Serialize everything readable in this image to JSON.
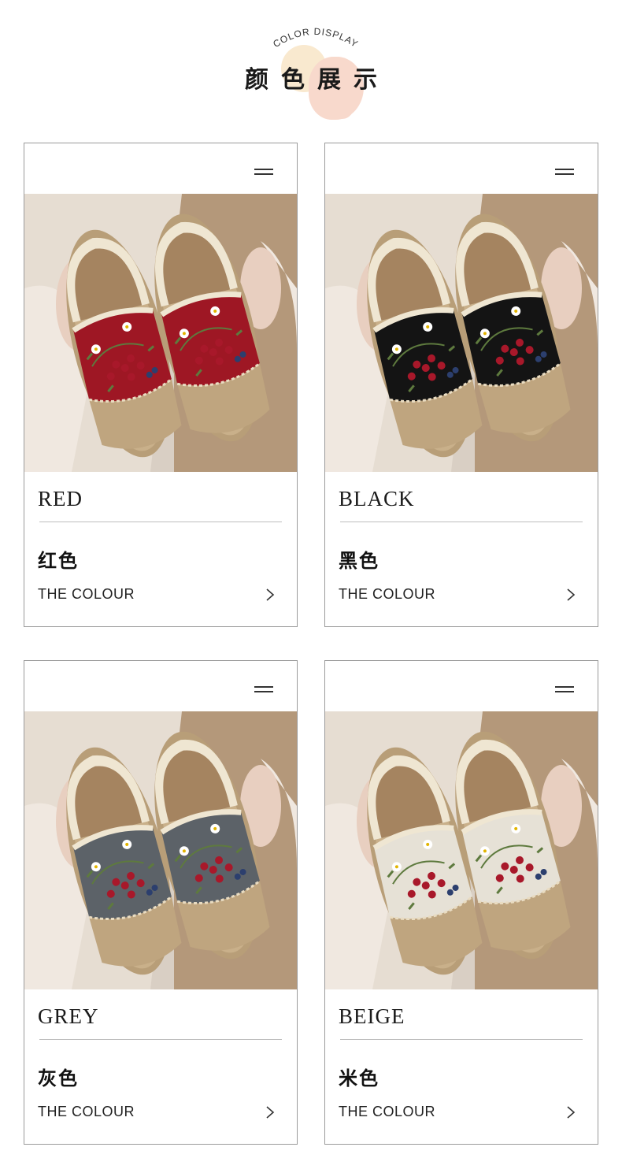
{
  "header": {
    "subtitle_en": "COLOR DISPLAY",
    "title_cn": "颜色展示"
  },
  "cards": [
    {
      "name_en": "RED",
      "name_cn": "红色",
      "sub": "THE COLOUR",
      "shoe_color": "#9e1724"
    },
    {
      "name_en": "BLACK",
      "name_cn": "黑色",
      "sub": "THE COLOUR",
      "shoe_color": "#141414"
    },
    {
      "name_en": "GREY",
      "name_cn": "灰色",
      "sub": "THE COLOUR",
      "shoe_color": "#5c6268"
    },
    {
      "name_en": "BEIGE",
      "name_cn": "米色",
      "sub": "THE COLOUR",
      "shoe_color": "#e6e1d6"
    }
  ],
  "icons": {
    "menu": "menu-icon",
    "chevron": "chevron-right-icon"
  }
}
